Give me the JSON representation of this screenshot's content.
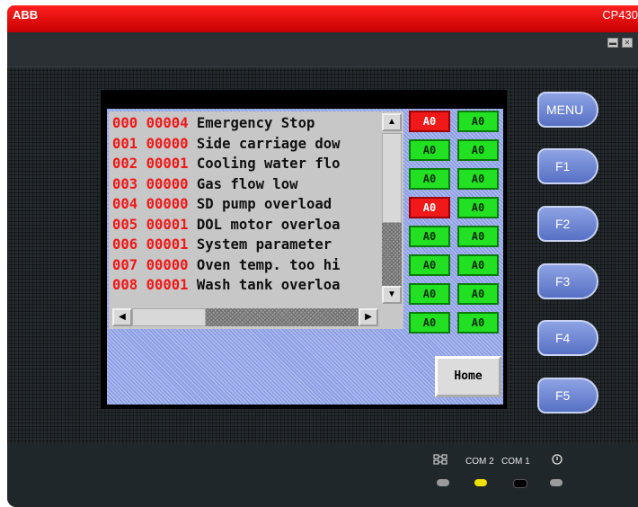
{
  "titlebar": {
    "brand": "ABB",
    "model": "CP430"
  },
  "window_controls": {
    "minimize": "▬",
    "close": "✕"
  },
  "alarm_list": [
    {
      "idx": "000",
      "count": "00004",
      "text": "Emergency Stop"
    },
    {
      "idx": "001",
      "count": "00000",
      "text": "Side carriage dow"
    },
    {
      "idx": "002",
      "count": "00001",
      "text": "Cooling water flo"
    },
    {
      "idx": "003",
      "count": "00000",
      "text": "Gas flow low"
    },
    {
      "idx": "004",
      "count": "00000",
      "text": "SD pump overload"
    },
    {
      "idx": "005",
      "count": "00001",
      "text": "DOL motor overloa"
    },
    {
      "idx": "006",
      "count": "00001",
      "text": "System parameter"
    },
    {
      "idx": "007",
      "count": "00000",
      "text": "Oven temp. too hi"
    },
    {
      "idx": "008",
      "count": "00001",
      "text": "Wash tank overloa"
    }
  ],
  "scroll": {
    "up": "▲",
    "down": "▼",
    "left": "◀",
    "right": "▶"
  },
  "status_cells": [
    {
      "left": {
        "text": "A0",
        "state": "red"
      },
      "right": {
        "text": "A0",
        "state": "green"
      }
    },
    {
      "left": {
        "text": "A0",
        "state": "green"
      },
      "right": {
        "text": "A0",
        "state": "green"
      }
    },
    {
      "left": {
        "text": "A0",
        "state": "green"
      },
      "right": {
        "text": "A0",
        "state": "green"
      }
    },
    {
      "left": {
        "text": "A0",
        "state": "red"
      },
      "right": {
        "text": "A0",
        "state": "green"
      }
    },
    {
      "left": {
        "text": "A0",
        "state": "green"
      },
      "right": {
        "text": "A0",
        "state": "green"
      }
    },
    {
      "left": {
        "text": "A0",
        "state": "green"
      },
      "right": {
        "text": "A0",
        "state": "green"
      }
    },
    {
      "left": {
        "text": "A0",
        "state": "green"
      },
      "right": {
        "text": "A0",
        "state": "green"
      }
    },
    {
      "left": {
        "text": "A0",
        "state": "green"
      },
      "right": {
        "text": "A0",
        "state": "green"
      }
    }
  ],
  "home_button": "Home",
  "function_keys": [
    "MENU",
    "F1",
    "F2",
    "F3",
    "F4",
    "F5"
  ],
  "status_leds": [
    {
      "label": "",
      "icon": "network-icon",
      "color": "#9a9a9a"
    },
    {
      "label": "COM 2",
      "color": "#f0e000"
    },
    {
      "label": "COM 1",
      "color": "#000000"
    },
    {
      "label": "",
      "icon": "power-icon",
      "color": "#9a9a9a"
    }
  ],
  "colors": {
    "brand_red": "#e00000",
    "alarm_red": "#f01818",
    "status_green": "#22e022",
    "key_blue": "#6f86d6"
  }
}
